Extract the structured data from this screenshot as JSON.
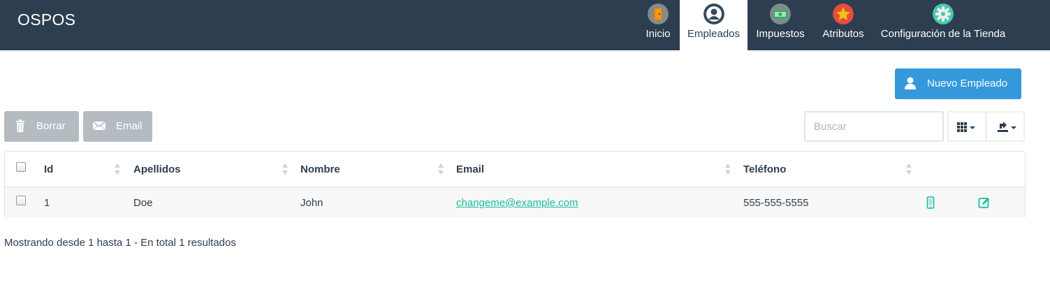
{
  "app": {
    "brand": "OSPOS"
  },
  "nav": {
    "items": [
      {
        "label": "Inicio",
        "icon": "door-icon",
        "color": "#7f8c8d"
      },
      {
        "label": "Empleados",
        "icon": "user-icon",
        "color": "#34495e"
      },
      {
        "label": "Impuestos",
        "icon": "money-icon",
        "color": "#7f8c8d"
      },
      {
        "label": "Atributos",
        "icon": "star-icon",
        "color": "#e74c3c"
      },
      {
        "label": "Configuración de la Tienda",
        "icon": "gear-icon",
        "color": "#48c9b0"
      }
    ],
    "active": "Empleados"
  },
  "actions": {
    "new_employee": "Nuevo Empleado"
  },
  "toolbar": {
    "delete_label": "Borrar",
    "email_label": "Email"
  },
  "search": {
    "placeholder": "Buscar",
    "value": ""
  },
  "table": {
    "columns": [
      "Id",
      "Apellidos",
      "Nombre",
      "Email",
      "Teléfono"
    ],
    "rows": [
      {
        "id": "1",
        "last_name": "Doe",
        "first_name": "John",
        "email": "changeme@example.com",
        "phone": "555-555-5555"
      }
    ]
  },
  "pagination": {
    "summary": "Mostrando desde 1 hasta 1 - En total 1 resultados"
  },
  "colors": {
    "navbar": "#2c3e50",
    "primary": "#3498db",
    "disabled": "#b4bcc2",
    "link": "#18bc9c"
  }
}
